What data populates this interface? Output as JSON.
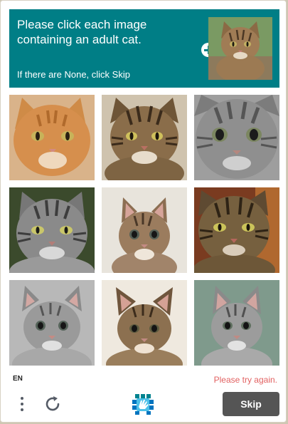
{
  "challenge": {
    "prompt": "Please click each image containing an adult cat.",
    "subtext": "If there are None, click Skip",
    "example_image": "cat-example-icon",
    "expand_icon": "plus-circle-icon"
  },
  "tiles": [
    {
      "name": "orange-tabby-cat"
    },
    {
      "name": "brown-tabby-cat"
    },
    {
      "name": "gray-tabby-cat-close-up"
    },
    {
      "name": "gray-tabby-cat"
    },
    {
      "name": "tabby-kitten"
    },
    {
      "name": "brown-tabby-cat-indoors"
    },
    {
      "name": "gray-kitten"
    },
    {
      "name": "tabby-kitten-lying"
    },
    {
      "name": "gray-tabby-kitten"
    }
  ],
  "footer": {
    "language": "EN",
    "error": "Please try again.",
    "skip_label": "Skip",
    "menu_icon": "more-vertical-icon",
    "refresh_icon": "refresh-icon",
    "logo_icon": "hcaptcha-logo-icon"
  },
  "colors": {
    "header": "#007e86",
    "error": "#e26161",
    "skip_button": "#555555"
  }
}
